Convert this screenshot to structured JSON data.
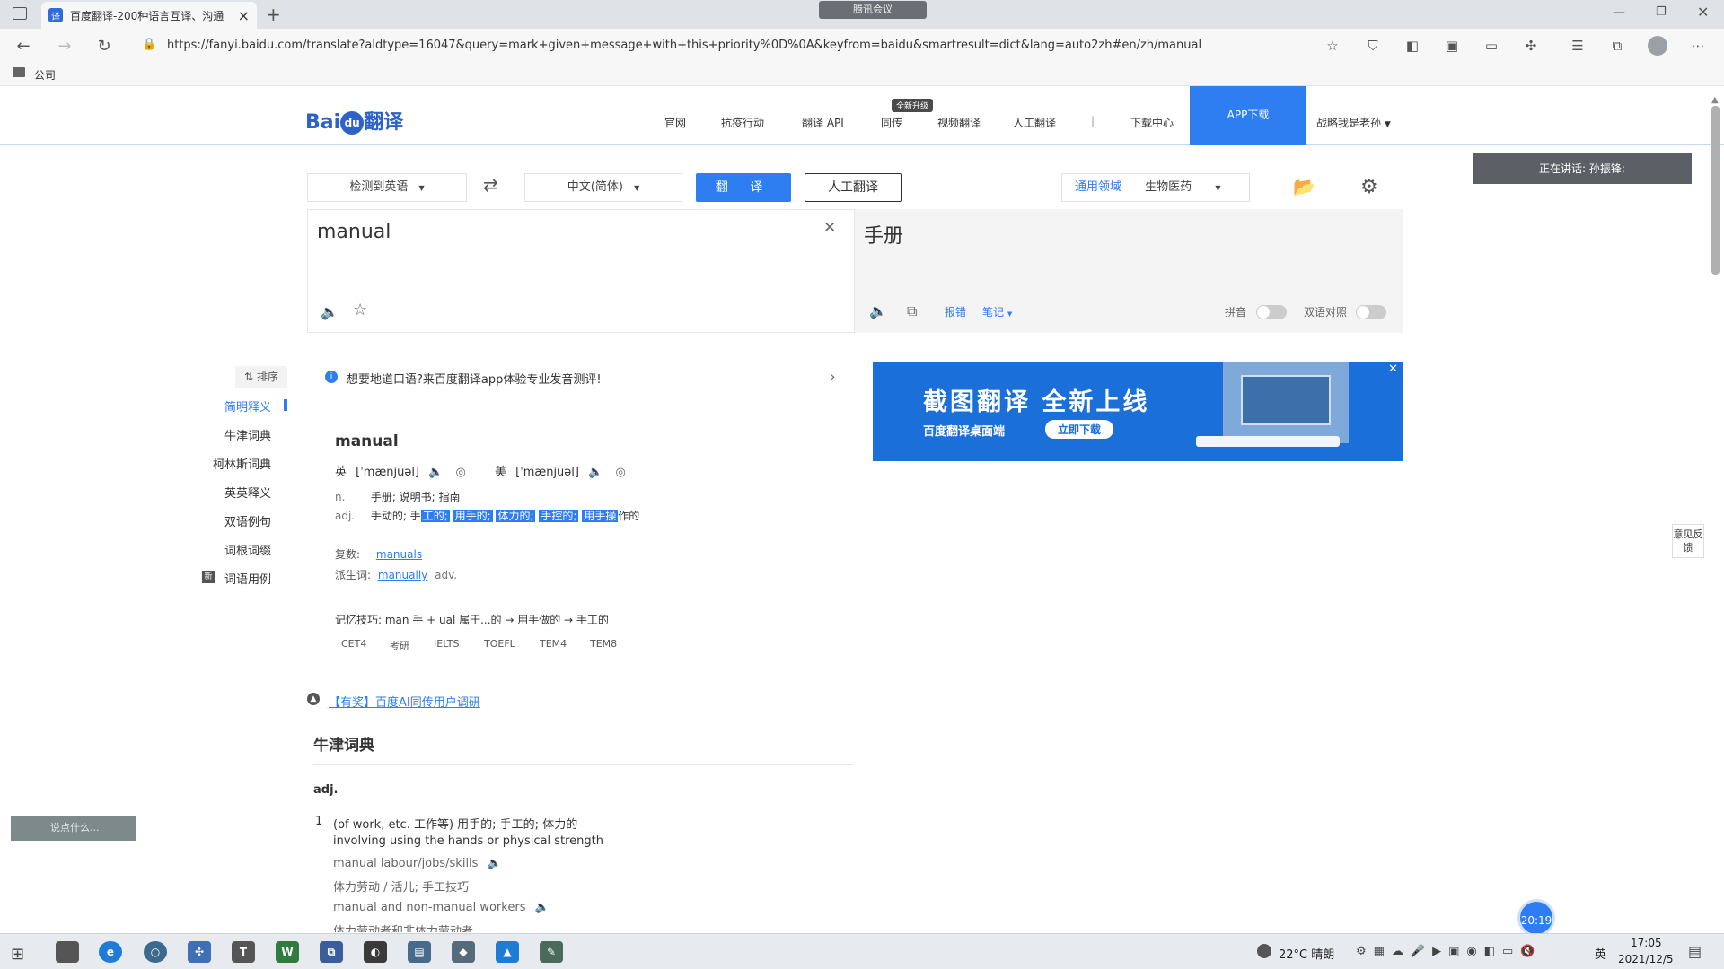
{
  "browser": {
    "tab_title": "百度翻译-200种语言互译、沟通",
    "tab_close": "×",
    "new_tab": "+",
    "meeting_label": "腾讯会议",
    "address": "https://fanyi.baidu.com/translate?aldtype=16047&query=mark+given+message+with+this+priority%0D%0A&keyfrom=baidu&smartresult=dict&lang=auto2zh#en/zh/manual",
    "bookmark_folder": "公司"
  },
  "header": {
    "logo_text": "Bai",
    "logo_paw": "du",
    "logo_suffix": "翻译",
    "nav": [
      "官网",
      "抗疫行动",
      "翻译 API",
      "同传",
      "视频翻译",
      "人工翻译",
      "|",
      "下载中心"
    ],
    "new_badge": "全新升级",
    "app_download": "APP下载",
    "user": "战略我是老孙"
  },
  "controls": {
    "source_lang": "检测到英语",
    "target_lang": "中文(简体)",
    "translate_btn": "翻 译",
    "human_btn": "人工翻译",
    "domain_general": "通用领域",
    "domain_bio": "生物医药"
  },
  "input": {
    "text": "manual"
  },
  "output": {
    "text": "手册",
    "report": "报错",
    "notes": "笔记",
    "pinyin": "拼音",
    "bilingual": "双语对照"
  },
  "speaker_notice": "正在讲话: 孙振锋;",
  "sidebar": {
    "sort": "排序",
    "items": [
      "简明释义",
      "牛津词典",
      "柯林斯词典",
      "英英释义",
      "双语例句",
      "词根词缀",
      "词语用例"
    ],
    "new_tag": "新"
  },
  "promo_line": "想要地道口语?来百度翻译app体验专业发音测评!",
  "banner": {
    "title": "截图翻译  全新上线",
    "sub": "百度翻译桌面端",
    "btn": "立即下载"
  },
  "entry": {
    "word": "manual",
    "uk_label": "英",
    "uk_phon": "[ˈmænjuəl]",
    "us_label": "美",
    "us_phon": "[ˈmænjuəl]",
    "n_pos": "n.",
    "n_defs": "手册;  说明书;  指南",
    "adj_pos": "adj.",
    "adj_plain1": "手动的;  手",
    "adj_hl": [
      "工的;",
      "用手的;",
      "体力的;",
      "手控的;",
      "用手操"
    ],
    "adj_tail": "作的",
    "plural_label": "复数:",
    "plural": "manuals",
    "deriv_label": "派生词:",
    "deriv": "manually",
    "deriv_pos": "adv.",
    "mnemonic": "记忆技巧: man 手 + ual 属于...的 → 用手做的 → 手工的",
    "tags": [
      "CET4",
      "考研",
      "IELTS",
      "TOEFL",
      "TEM4",
      "TEM8"
    ]
  },
  "survey_link": "【有奖】百度AI同传用户调研",
  "oxford": {
    "title": "牛津词典",
    "pos": "adj.",
    "num": "1",
    "def_line1": "(of work, etc. 工作等) 用手的;  手工的;  体力的",
    "def_line2": "involving using the hands or physical strength",
    "ex1": "manual labour/jobs/skills",
    "ex1_cn": "体力劳动 / 活儿;  手工技巧",
    "ex2": "manual and non-manual workers",
    "ex2_cn": "体力劳动者和非体力劳动者"
  },
  "feedback": "意见反馈",
  "left_widget": "说点什么...",
  "timer": "20:19",
  "taskbar": {
    "weather": "22°C  晴朗",
    "ime": "英",
    "time": "17:05",
    "date": "2021/12/5"
  }
}
